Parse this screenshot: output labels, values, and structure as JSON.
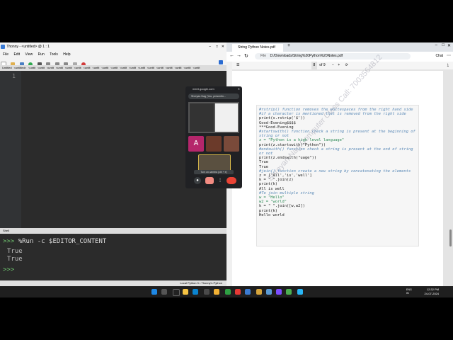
{
  "thonny": {
    "title": "Thonny - <untitled> @ 1 : 1",
    "menu": [
      "File",
      "Edit",
      "View",
      "Run",
      "Tools",
      "Help"
    ],
    "tabs": [
      "Untitled",
      "<untitled>",
      "<untit",
      "<untit",
      "<untit",
      "<untit",
      "<untit",
      "<untit",
      "<untit",
      "<untit",
      "<untit",
      "<untit",
      "<untit",
      "<untit",
      "<untit",
      "<untit",
      "<untit",
      "<untit",
      "<untit",
      "<untit",
      "<untit"
    ],
    "line_number": "1",
    "shell_tab": "Shell",
    "shell_prompt": ">>>",
    "shell_command": "%Run -c $EDITOR_CONTENT",
    "shell_output": [
      "True",
      "True"
    ],
    "status": "Local Python 3 • Thonny's Python"
  },
  "browser": {
    "tab_title": "String Python Notes.pdf",
    "url": "D:/Downloads/String%20Python%20Notes.pdf",
    "file_label": "File",
    "page_num": "8",
    "page_total": "of 9",
    "chat_label": "Chat"
  },
  "pdf": {
    "lines": [
      {
        "t": "#rstrip() function removes the whitespaces from the right hand side",
        "c": "cm"
      },
      {
        "t": "#if a character is mentioned that is removed from the right side",
        "c": "cm"
      },
      {
        "t": "print(s.rstrip('$'))",
        "c": ""
      },
      {
        "t": " ",
        "c": ""
      },
      {
        "t": "Good-Evening$$$$",
        "c": ""
      },
      {
        "t": "***Good-Evening",
        "c": ""
      },
      {
        "t": " ",
        "c": ""
      },
      {
        "t": "#startswith() function check a string is present at the beginning of",
        "c": "cm"
      },
      {
        "t": "string or not",
        "c": "cm"
      },
      {
        "t": "z = \"Python is a high level language\"",
        "c": "st"
      },
      {
        "t": "print(z.startswith(\"Python\"))",
        "c": ""
      },
      {
        "t": "#endswith() function check a string is present at the end of string",
        "c": "cm"
      },
      {
        "t": "or not",
        "c": "cm"
      },
      {
        "t": "print(z.endswith(\"uage\"))",
        "c": ""
      },
      {
        "t": " ",
        "c": ""
      },
      {
        "t": "True",
        "c": ""
      },
      {
        "t": "True",
        "c": ""
      },
      {
        "t": " ",
        "c": ""
      },
      {
        "t": "#join() function create a new string by concatenating the elements",
        "c": "cm"
      },
      {
        "t": "z = ['All','is','well']",
        "c": ""
      },
      {
        "t": "k = \" \".join(z)",
        "c": ""
      },
      {
        "t": "print(k)",
        "c": ""
      },
      {
        "t": " ",
        "c": ""
      },
      {
        "t": "All is well",
        "c": ""
      },
      {
        "t": " ",
        "c": ""
      },
      {
        "t": "#To join multiple string",
        "c": "cm"
      },
      {
        "t": "w = \"Hello\"",
        "c": "st"
      },
      {
        "t": "w2 = \"world\"",
        "c": "st"
      },
      {
        "t": "k = \" \".join([w,w2])",
        "c": ""
      },
      {
        "t": "print(k)",
        "c": ""
      },
      {
        "t": " ",
        "c": ""
      },
      {
        "t": "Hello world",
        "c": ""
      }
    ],
    "watermark": "Shreyan Nag Computer Class Call: 7003564812"
  },
  "meet": {
    "host": "meet.google.com",
    "presenter": "Shreyan Nag (You, presentin...",
    "avatar_letter": "A",
    "tooltip": "Turn on camera (ctrl + e)"
  },
  "taskbar": {
    "lang": "ENG\nIN",
    "time": "12:32 PM",
    "date": "24-07-2024"
  },
  "colors": {
    "shell_bg": "#2b2b2b",
    "meet_bg": "#202124",
    "hangup": "#ea4335",
    "avatar": "#b5266b"
  }
}
